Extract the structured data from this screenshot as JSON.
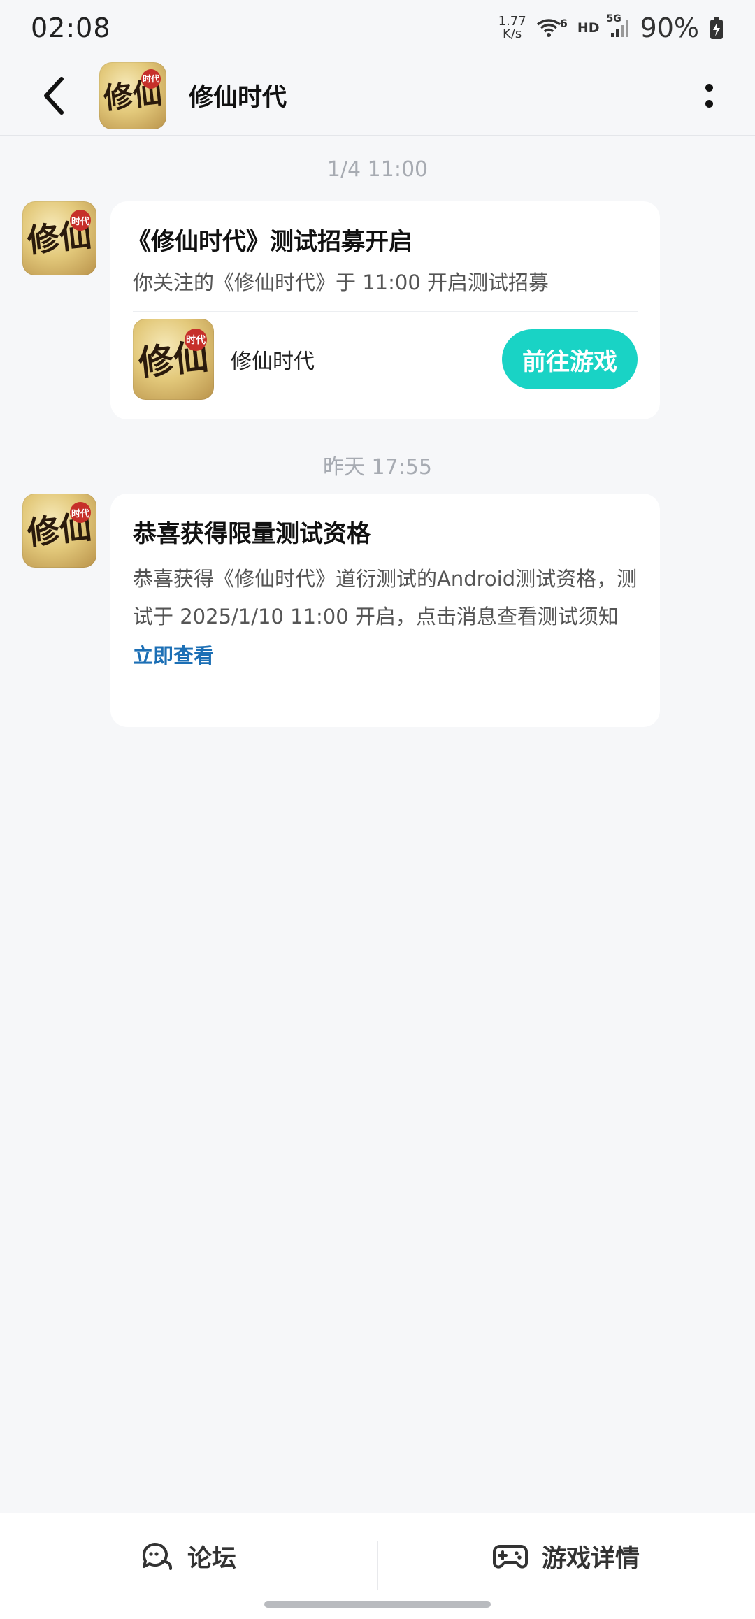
{
  "status_bar": {
    "time": "02:08",
    "net_speed_value": "1.77",
    "net_speed_unit": "K/s",
    "wifi_badge": "6",
    "hd": "HD",
    "signal_label": "5G",
    "battery": "90%"
  },
  "header": {
    "title": "修仙时代",
    "back_icon": "chevron-left-icon",
    "more_icon": "more-vertical-icon"
  },
  "avatar": {
    "glyphs": "修仙",
    "seal": "时代"
  },
  "messages": [
    {
      "timestamp": "1/4  11:00",
      "title": "《修仙时代》测试招募开启",
      "description": "你关注的《修仙时代》于 11:00 开启测试招募",
      "game_name": "修仙时代",
      "button_label": "前往游戏"
    },
    {
      "timestamp": "昨天  17:55",
      "title": "恭喜获得限量测试资格",
      "body": "恭喜获得《修仙时代》道衍测试的Android测试资格，测试于 2025/1/10 11:00 开启，点击消息查看测试须知",
      "link_label": "立即查看"
    }
  ],
  "bottom_bar": {
    "tabs": [
      {
        "label": "论坛",
        "icon": "chat-bubbles-icon"
      },
      {
        "label": "游戏详情",
        "icon": "gamepad-icon"
      }
    ]
  },
  "colors": {
    "accent": "#19d3c5",
    "link": "#1c6fb5",
    "background": "#f6f7f9"
  }
}
